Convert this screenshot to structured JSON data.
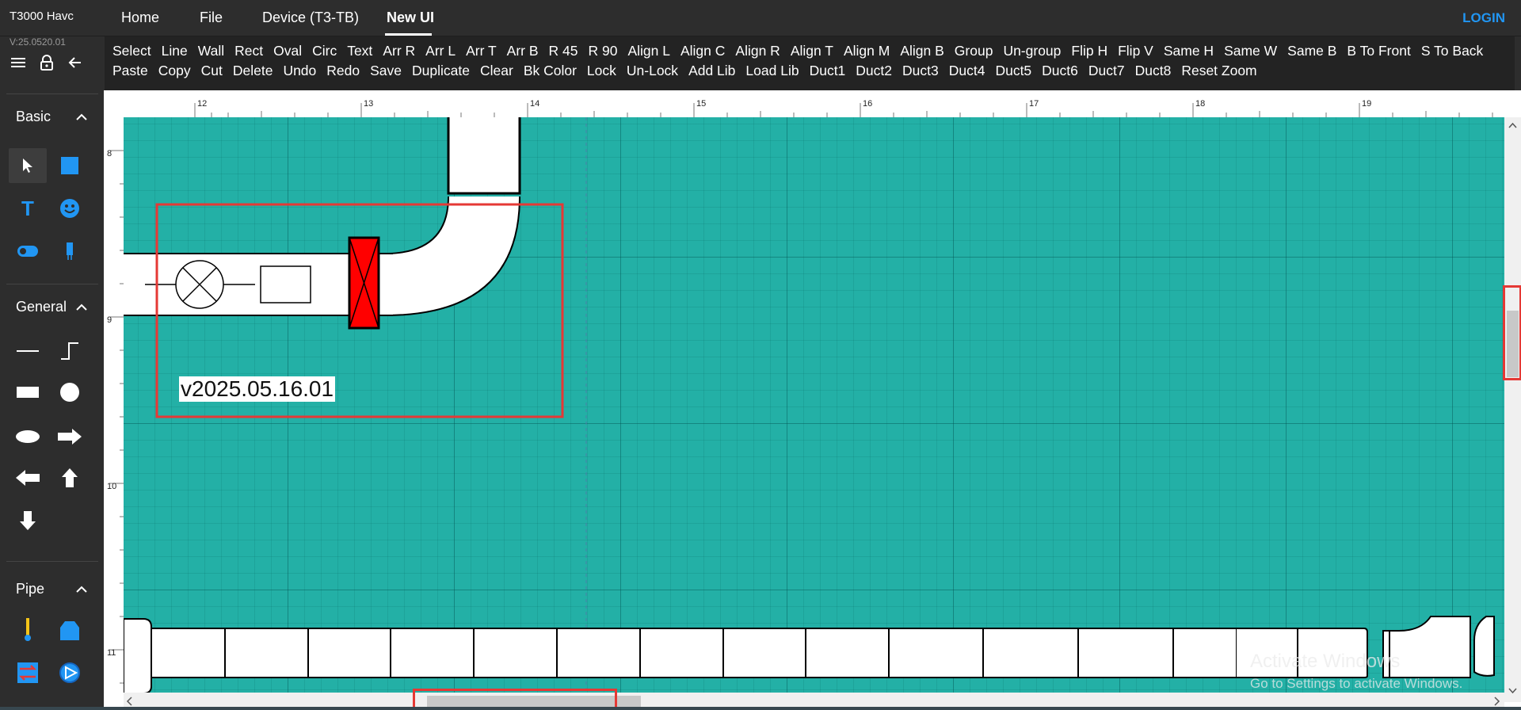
{
  "app": {
    "title": "T3000 Havc",
    "version": "V:25.0520.01"
  },
  "nav": {
    "tabs": [
      "Home",
      "File",
      "Device (T3-TB)",
      "New UI"
    ],
    "active_tab": "New UI",
    "login": "LOGIN"
  },
  "toolbar": {
    "row1": [
      "Select",
      "Line",
      "Wall",
      "Rect",
      "Oval",
      "Circ",
      "Text",
      "Arr R",
      "Arr L",
      "Arr T",
      "Arr B",
      "R 45",
      "R 90",
      "Align L",
      "Align C",
      "Align R",
      "Align T",
      "Align M",
      "Align B",
      "Group",
      "Un-group",
      "Flip H",
      "Flip V",
      "Same H",
      "Same W",
      "Same B",
      "B To Front",
      "S To Back"
    ],
    "row2": [
      "Paste",
      "Copy",
      "Cut",
      "Delete",
      "Undo",
      "Redo",
      "Save",
      "Duplicate",
      "Clear",
      "Bk Color",
      "Lock",
      "Un-Lock",
      "Add Lib",
      "Load Lib",
      "Duct1",
      "Duct2",
      "Duct3",
      "Duct4",
      "Duct5",
      "Duct6",
      "Duct7",
      "Duct8",
      "Reset Zoom"
    ]
  },
  "panel": {
    "sections": [
      {
        "title": "Basic",
        "icons": [
          "pointer-icon",
          "rectangle-fill-icon",
          "text-icon",
          "emoji-icon",
          "toggle-icon",
          "sensor-icon"
        ]
      },
      {
        "title": "General",
        "icons": [
          "line-icon",
          "step-line-icon",
          "bar-icon",
          "circle-icon",
          "ellipse-icon",
          "arrow-right-icon",
          "arrow-left-icon",
          "arrow-up-icon",
          "arrow-down-icon"
        ]
      },
      {
        "title": "Pipe",
        "icons": [
          "thermometer-icon",
          "damper-icon",
          "heat-exchanger-icon",
          "pump-icon"
        ]
      }
    ]
  },
  "canvas": {
    "ruler_x": [
      "12",
      "13",
      "14",
      "15",
      "16",
      "17",
      "18",
      "19"
    ],
    "ruler_y": [
      "8",
      "9",
      "10",
      "11"
    ],
    "label": "v2025.05.16.01",
    "background": "#23b0a6",
    "selection_color": "#e53935",
    "damper_color": "#ff0000"
  },
  "watermark": {
    "line1": "Activate Windows",
    "line2": "Go to Settings to activate Windows."
  }
}
